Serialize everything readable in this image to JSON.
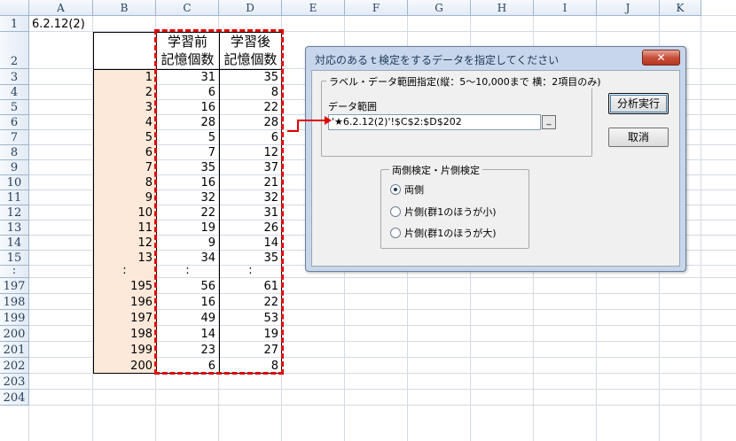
{
  "columns": [
    "A",
    "B",
    "C",
    "D",
    "E",
    "F",
    "G",
    "H",
    "I",
    "J",
    "K"
  ],
  "rows": [
    "1",
    "2",
    "3",
    "4",
    "5",
    "6",
    "7",
    "8",
    "9",
    "10",
    "11",
    "12",
    "13",
    "14",
    "15",
    ":",
    "197",
    "198",
    "199",
    "200",
    "201",
    "202",
    "203",
    "204"
  ],
  "sheet": {
    "a1": "6.2.12(2)",
    "header_c": [
      "学習前",
      "記憶個数"
    ],
    "header_d": [
      "学習後",
      "記憶個数"
    ],
    "data_rows": [
      {
        "b": "1",
        "c": "31",
        "d": "35"
      },
      {
        "b": "2",
        "c": "6",
        "d": "8"
      },
      {
        "b": "3",
        "c": "16",
        "d": "22"
      },
      {
        "b": "4",
        "c": "28",
        "d": "28"
      },
      {
        "b": "5",
        "c": "5",
        "d": "6"
      },
      {
        "b": "6",
        "c": "7",
        "d": "12"
      },
      {
        "b": "7",
        "c": "35",
        "d": "37"
      },
      {
        "b": "8",
        "c": "16",
        "d": "21"
      },
      {
        "b": "9",
        "c": "32",
        "d": "32"
      },
      {
        "b": "10",
        "c": "22",
        "d": "31"
      },
      {
        "b": "11",
        "c": "19",
        "d": "26"
      },
      {
        "b": "12",
        "c": "9",
        "d": "14"
      },
      {
        "b": "13",
        "c": "34",
        "d": "35"
      },
      {
        "b": ":",
        "c": ":",
        "d": ":"
      },
      {
        "b": "195",
        "c": "56",
        "d": "61"
      },
      {
        "b": "196",
        "c": "16",
        "d": "22"
      },
      {
        "b": "197",
        "c": "49",
        "d": "53"
      },
      {
        "b": "198",
        "c": "14",
        "d": "19"
      },
      {
        "b": "199",
        "c": "23",
        "d": "27"
      },
      {
        "b": "200",
        "c": "6",
        "d": "8"
      }
    ]
  },
  "dialog": {
    "title": "対応のあるｔ検定をするデータを指定してください",
    "close_label": "✕",
    "range_group_label": "ラベル・データ範囲指定(縦：5～10,000まで 横：2項目のみ)",
    "range_label": "データ範囲",
    "range_value": "'★6.2.12(2)'!$C$2:$D$202",
    "ref_button_label": "_",
    "run_button": "分析実行",
    "cancel_button": "取消",
    "test_group_label": "両側検定・片側検定",
    "options": [
      {
        "label": "両側",
        "checked": true
      },
      {
        "label": "片側(群1のほうが小)",
        "checked": false
      },
      {
        "label": "片側(群1のほうが大)",
        "checked": false
      }
    ]
  },
  "colors": {
    "highlight": "#fde9d9",
    "dashed": "#e00000",
    "arrow": "#e00000"
  }
}
